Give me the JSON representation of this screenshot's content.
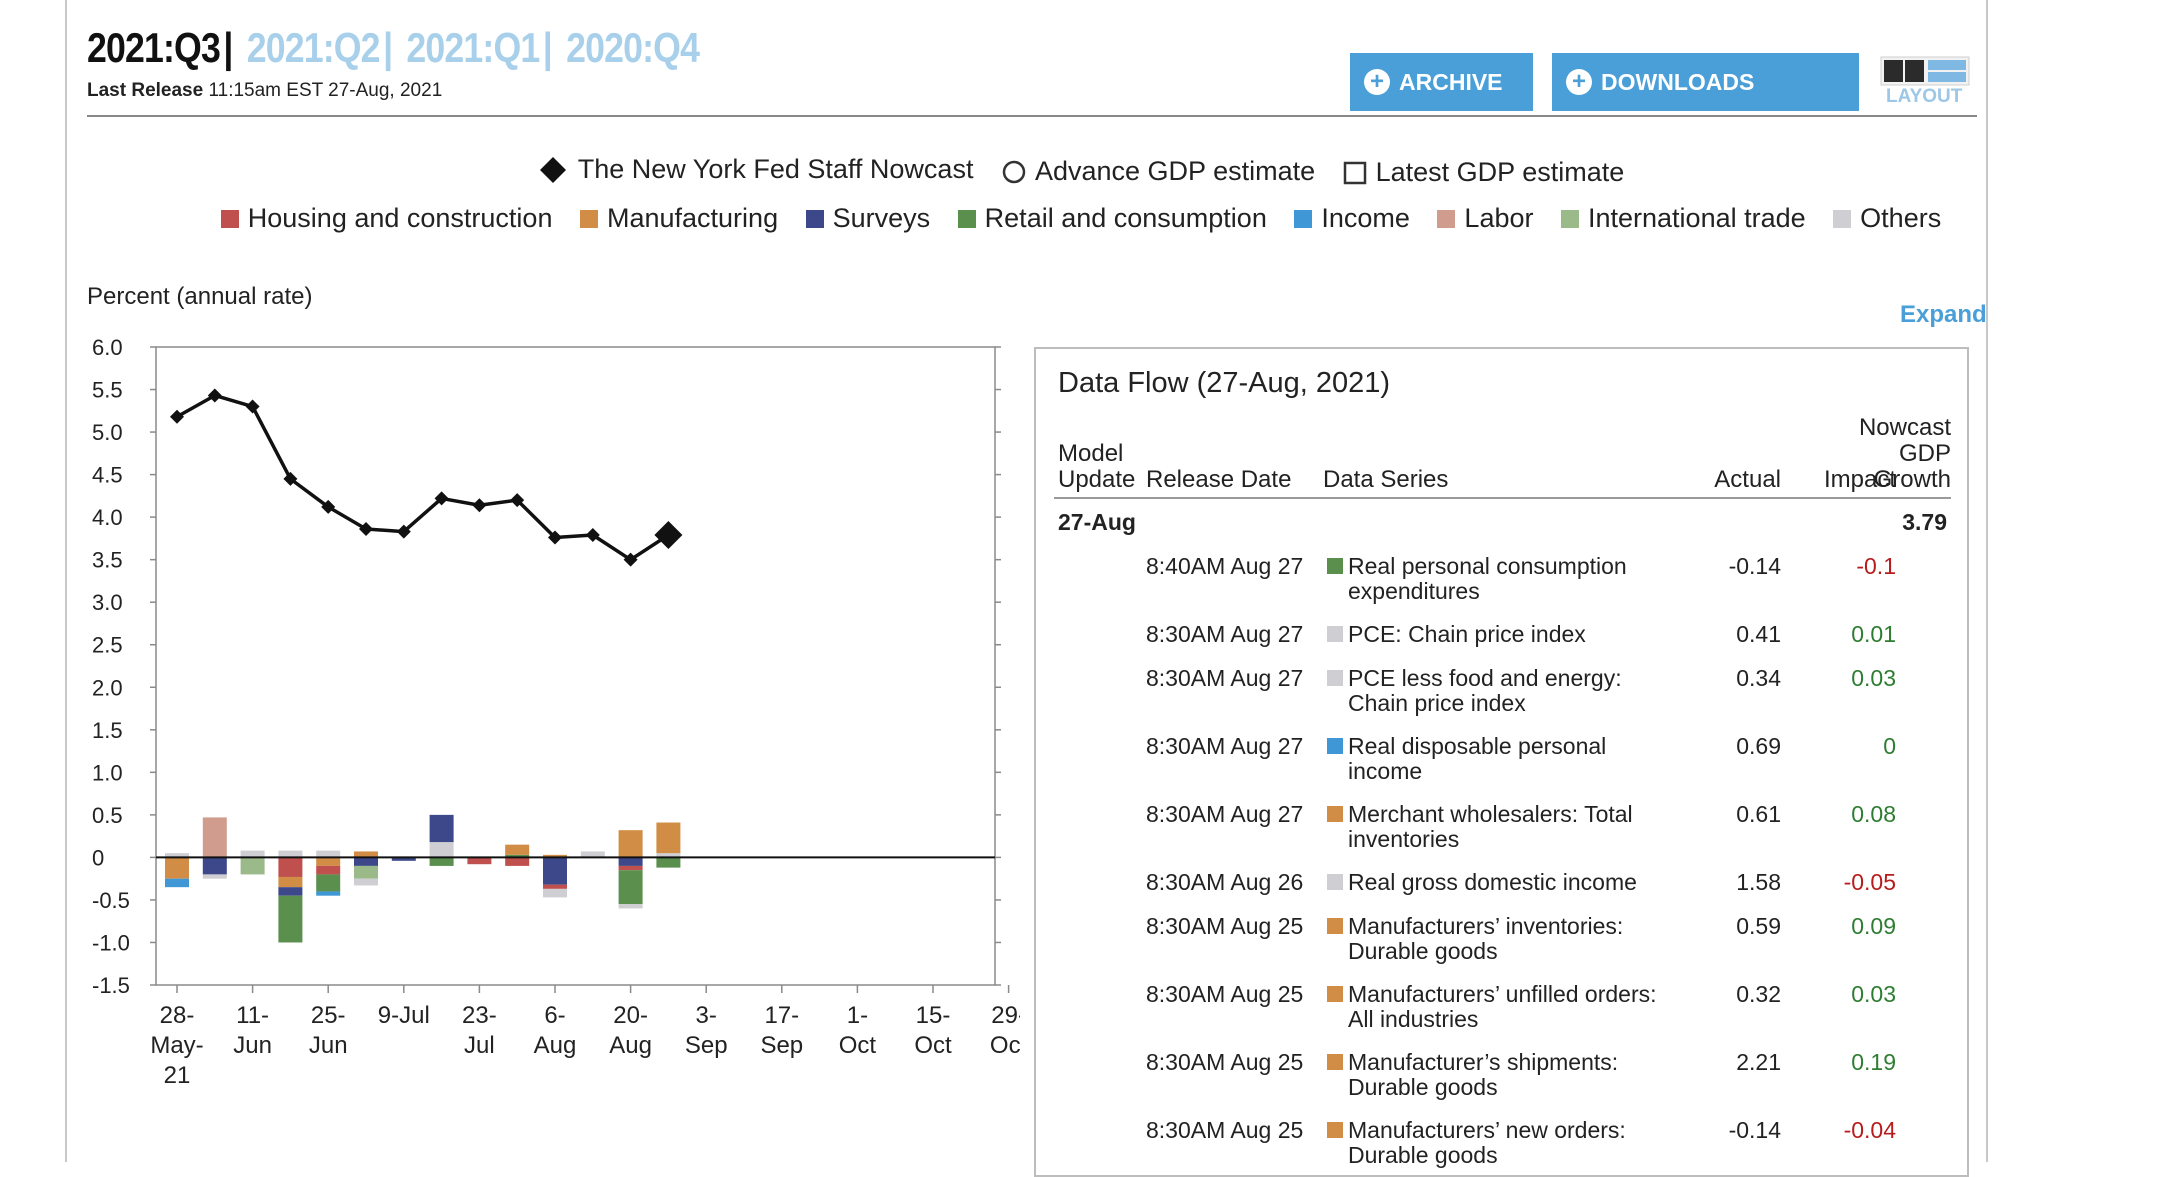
{
  "header": {
    "current_quarter": "2021:Q3",
    "other_quarters": [
      "2021:Q2",
      "2021:Q1",
      "2020:Q4"
    ],
    "release_label": "Last Release",
    "release_time": "11:15am EST 27-Aug, 2021",
    "archive_label": "ARCHIVE",
    "downloads_label": "DOWNLOADS",
    "layout_label": "LAYOUT"
  },
  "legend": {
    "nowcast": "The New York Fed Staff Nowcast",
    "advance": "Advance GDP estimate",
    "latest": "Latest GDP estimate",
    "categories": [
      {
        "name": "Housing and construction",
        "color": "#c0504d"
      },
      {
        "name": "Manufacturing",
        "color": "#d18c45"
      },
      {
        "name": "Surveys",
        "color": "#3c4889"
      },
      {
        "name": "Retail and consumption",
        "color": "#5a8f4e"
      },
      {
        "name": "Income",
        "color": "#3f97d6"
      },
      {
        "name": "Labor",
        "color": "#cf9c8e"
      },
      {
        "name": "International trade",
        "color": "#9bba8a"
      },
      {
        "name": "Others",
        "color": "#cfcfd3"
      }
    ]
  },
  "chart_label": "Percent (annual rate)",
  "expand_label": "Expand",
  "chart_data": {
    "type": "line",
    "ylim": [
      -1.5,
      6.0
    ],
    "yticks": [
      "6.0",
      "5.5",
      "5.0",
      "4.5",
      "4.0",
      "3.5",
      "3.0",
      "2.5",
      "2.0",
      "1.5",
      "1.0",
      "0.5",
      "0",
      "-0.5",
      "-1.0",
      "-1.5"
    ],
    "xticks": [
      {
        "day": 0,
        "lines": [
          "28-",
          "May-",
          "21"
        ]
      },
      {
        "day": 14,
        "lines": [
          "11-",
          "Jun"
        ]
      },
      {
        "day": 28,
        "lines": [
          "25-",
          "Jun"
        ]
      },
      {
        "day": 42,
        "lines": [
          "9-Jul"
        ]
      },
      {
        "day": 56,
        "lines": [
          "23-",
          "Jul"
        ]
      },
      {
        "day": 70,
        "lines": [
          "6-",
          "Aug"
        ]
      },
      {
        "day": 84,
        "lines": [
          "20-",
          "Aug"
        ]
      },
      {
        "day": 98,
        "lines": [
          "3-",
          "Sep"
        ]
      },
      {
        "day": 112,
        "lines": [
          "17-",
          "Sep"
        ]
      },
      {
        "day": 126,
        "lines": [
          "1-",
          "Oct"
        ]
      },
      {
        "day": 140,
        "lines": [
          "15-",
          "Oct"
        ]
      },
      {
        "day": 154,
        "lines": [
          "29-",
          "Oct"
        ]
      }
    ],
    "nowcast": {
      "name": "The New York Fed Staff Nowcast",
      "day": [
        0,
        7,
        14,
        21,
        28,
        35,
        42,
        49,
        56,
        63,
        70,
        77,
        84,
        91
      ],
      "value": [
        5.18,
        5.43,
        5.3,
        4.45,
        4.12,
        3.86,
        3.83,
        4.22,
        4.14,
        4.2,
        3.76,
        3.79,
        3.5,
        3.79
      ]
    },
    "contributions": [
      {
        "day": 0,
        "segments": [
          {
            "category": "Others",
            "value": 0.05
          },
          {
            "category": "Manufacturing",
            "value": -0.25
          },
          {
            "category": "Income",
            "value": -0.1
          }
        ]
      },
      {
        "day": 7,
        "segments": [
          {
            "category": "Labor",
            "value": 0.47
          },
          {
            "category": "Surveys",
            "value": -0.2
          },
          {
            "category": "Others",
            "value": -0.05
          }
        ]
      },
      {
        "day": 14,
        "segments": [
          {
            "category": "Others",
            "value": 0.08
          },
          {
            "category": "International trade",
            "value": -0.2
          }
        ]
      },
      {
        "day": 21,
        "segments": [
          {
            "category": "Others",
            "value": 0.08
          },
          {
            "category": "Housing and construction",
            "value": -0.23
          },
          {
            "category": "Manufacturing",
            "value": -0.12
          },
          {
            "category": "Surveys",
            "value": -0.1
          },
          {
            "category": "Retail and consumption",
            "value": -0.55
          }
        ]
      },
      {
        "day": 28,
        "segments": [
          {
            "category": "Others",
            "value": 0.08
          },
          {
            "category": "Manufacturing",
            "value": -0.1
          },
          {
            "category": "Housing and construction",
            "value": -0.1
          },
          {
            "category": "Retail and consumption",
            "value": -0.2
          },
          {
            "category": "Income",
            "value": -0.05
          }
        ]
      },
      {
        "day": 35,
        "segments": [
          {
            "category": "Manufacturing",
            "value": 0.07
          },
          {
            "category": "Surveys",
            "value": -0.1
          },
          {
            "category": "International trade",
            "value": -0.15
          },
          {
            "category": "Others",
            "value": -0.08
          }
        ]
      },
      {
        "day": 42,
        "segments": [
          {
            "category": "Surveys",
            "value": -0.04
          }
        ]
      },
      {
        "day": 49,
        "segments": [
          {
            "category": "Others",
            "value": 0.18
          },
          {
            "category": "Surveys",
            "value": 0.32
          },
          {
            "category": "Retail and consumption",
            "value": -0.1
          }
        ]
      },
      {
        "day": 56,
        "segments": [
          {
            "category": "Housing and construction",
            "value": -0.08
          }
        ]
      },
      {
        "day": 63,
        "segments": [
          {
            "category": "Retail and consumption",
            "value": 0.03
          },
          {
            "category": "Manufacturing",
            "value": 0.12
          },
          {
            "category": "Housing and construction",
            "value": -0.1
          }
        ]
      },
      {
        "day": 70,
        "segments": [
          {
            "category": "Manufacturing",
            "value": 0.03
          },
          {
            "category": "Surveys",
            "value": -0.32
          },
          {
            "category": "Housing and construction",
            "value": -0.05
          },
          {
            "category": "Others",
            "value": -0.1
          }
        ]
      },
      {
        "day": 77,
        "segments": [
          {
            "category": "Others",
            "value": 0.07
          }
        ]
      },
      {
        "day": 84,
        "segments": [
          {
            "category": "Manufacturing",
            "value": 0.32
          },
          {
            "category": "Surveys",
            "value": -0.1
          },
          {
            "category": "Housing and construction",
            "value": -0.05
          },
          {
            "category": "Retail and consumption",
            "value": -0.4
          },
          {
            "category": "Others",
            "value": -0.05
          }
        ]
      },
      {
        "day": 91,
        "segments": [
          {
            "category": "Others",
            "value": 0.05
          },
          {
            "category": "Manufacturing",
            "value": 0.36
          },
          {
            "category": "Retail and consumption",
            "value": -0.12
          }
        ]
      }
    ]
  },
  "data_flow": {
    "title": "Data Flow (27-Aug, 2021)",
    "columns": {
      "model_update": [
        "Model",
        "Update"
      ],
      "release_date": "Release Date",
      "data_series": "Data Series",
      "actual": "Actual",
      "impact": "Impact",
      "nowcast": [
        "Nowcast",
        "GDP",
        "Growth"
      ]
    },
    "update_date": "27-Aug",
    "nowcast_value": "3.79",
    "rows": [
      {
        "release": "8:40AM Aug 27",
        "series": "Real personal consumption expenditures",
        "actual": "-0.14",
        "impact": "-0.1",
        "sign": "neg",
        "color": "#5a8f4e"
      },
      {
        "release": "8:30AM Aug 27",
        "series": "PCE: Chain price index",
        "actual": "0.41",
        "impact": "0.01",
        "sign": "pos",
        "color": "#cfcfd3"
      },
      {
        "release": "8:30AM Aug 27",
        "series": "PCE less food and energy: Chain price index",
        "actual": "0.34",
        "impact": "0.03",
        "sign": "pos",
        "color": "#cfcfd3"
      },
      {
        "release": "8:30AM Aug 27",
        "series": "Real disposable personal income",
        "actual": "0.69",
        "impact": "0",
        "sign": "zero",
        "color": "#3f97d6"
      },
      {
        "release": "8:30AM Aug 27",
        "series": "Merchant wholesalers: Total inventories",
        "actual": "0.61",
        "impact": "0.08",
        "sign": "pos",
        "color": "#d18c45"
      },
      {
        "release": "8:30AM Aug 26",
        "series": "Real gross domestic income",
        "actual": "1.58",
        "impact": "-0.05",
        "sign": "neg",
        "color": "#cfcfd3"
      },
      {
        "release": "8:30AM Aug 25",
        "series": "Manufacturers’ inventories: Durable goods",
        "actual": "0.59",
        "impact": "0.09",
        "sign": "pos",
        "color": "#d18c45"
      },
      {
        "release": "8:30AM Aug 25",
        "series": "Manufacturers’ unfilled orders: All industries",
        "actual": "0.32",
        "impact": "0.03",
        "sign": "pos",
        "color": "#d18c45"
      },
      {
        "release": "8:30AM Aug 25",
        "series": "Manufacturer’s shipments: Durable goods",
        "actual": "2.21",
        "impact": "0.19",
        "sign": "pos",
        "color": "#d18c45"
      },
      {
        "release": "8:30AM Aug 25",
        "series": "Manufacturers’ new orders: Durable goods",
        "actual": "-0.14",
        "impact": "-0.04",
        "sign": "neg",
        "color": "#d18c45"
      }
    ]
  }
}
